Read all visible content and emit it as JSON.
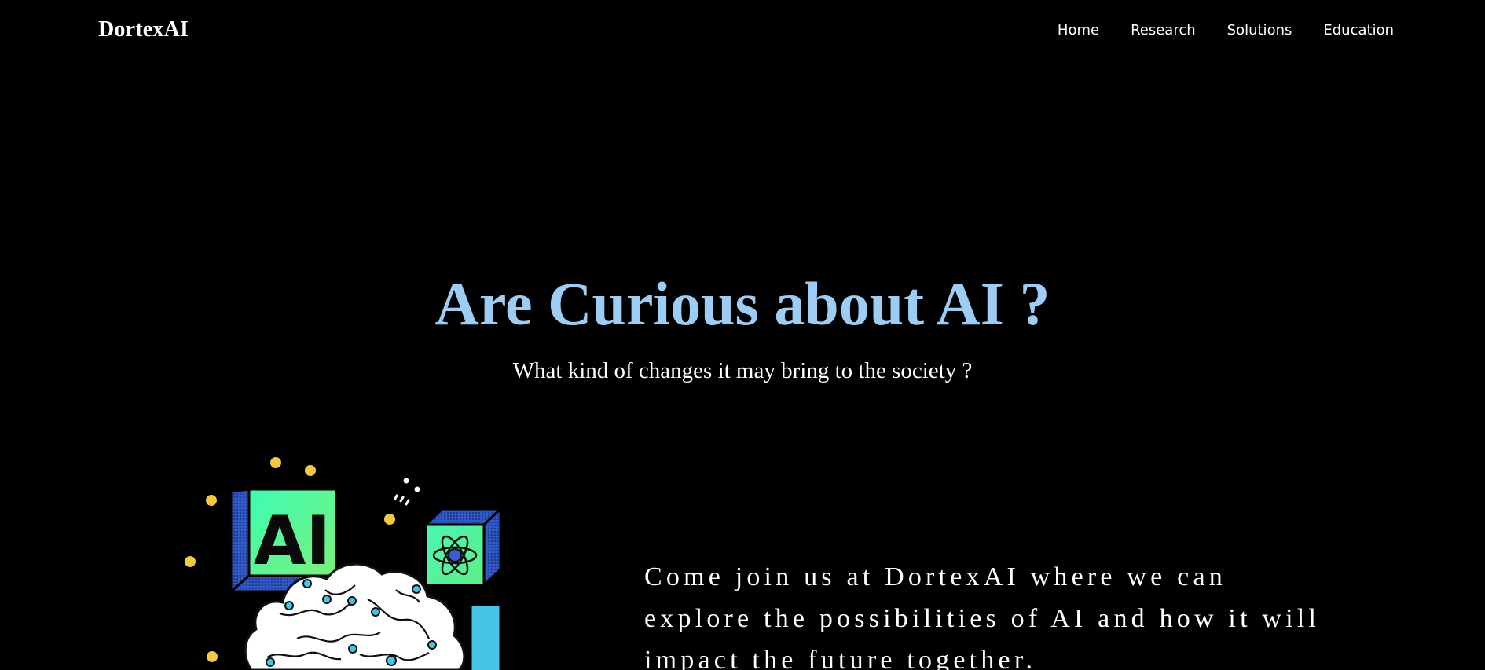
{
  "nav": {
    "brand": "DortexAI",
    "links": [
      "Home",
      "Research",
      "Solutions",
      "Education"
    ]
  },
  "hero": {
    "title": "Are Curious about AI ?",
    "subtitle": "What kind of changes it may bring to the society ?"
  },
  "illustration": {
    "icon": "ai-brain-illustration",
    "badge_text": "AI"
  },
  "intro": {
    "text": "Come join us at DortexAI where we can explore the possibilities of AI and how it will impact the future together."
  },
  "colors": {
    "background": "#000000",
    "title": "#9dcdf4",
    "text": "#ffffff",
    "accent_green": "#3dfcb4",
    "accent_blue": "#2f58c8",
    "accent_yellow": "#f5c842",
    "accent_cyan": "#45c4e6"
  }
}
